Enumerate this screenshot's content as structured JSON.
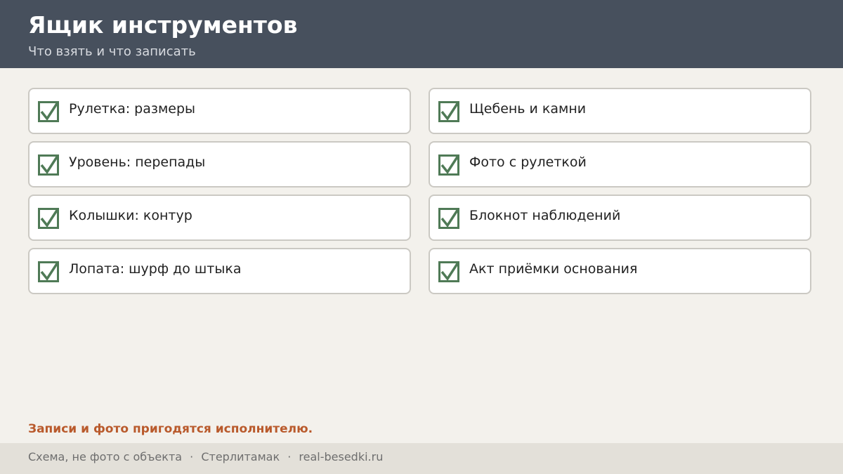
{
  "header": {
    "title": "Ящик инструментов",
    "subtitle": "Что взять и что записать"
  },
  "checklist": {
    "check_icon": "checkmark-icon",
    "check_color": "#4f7a56",
    "items": [
      {
        "label": "Рулетка: размеры",
        "checked": true
      },
      {
        "label": "Уровень: перепады",
        "checked": true
      },
      {
        "label": "Колышки: контур",
        "checked": true
      },
      {
        "label": "Лопата: шурф до штыка",
        "checked": true
      },
      {
        "label": "Щебень и камни",
        "checked": true
      },
      {
        "label": "Фото с рулеткой",
        "checked": true
      },
      {
        "label": "Блокнот наблюдений",
        "checked": true
      },
      {
        "label": "Акт приёмки основания",
        "checked": true
      }
    ]
  },
  "note": "Записи и фото пригодятся исполнителю.",
  "footer": {
    "disclaimer": "Схема, не фото с объекта",
    "separator": "·",
    "city": "Стерлитамак",
    "site": "real-besedki.ru"
  },
  "colors": {
    "header_bg": "#47505d",
    "accent": "#b95a2c",
    "background": "#f3f1ec"
  }
}
